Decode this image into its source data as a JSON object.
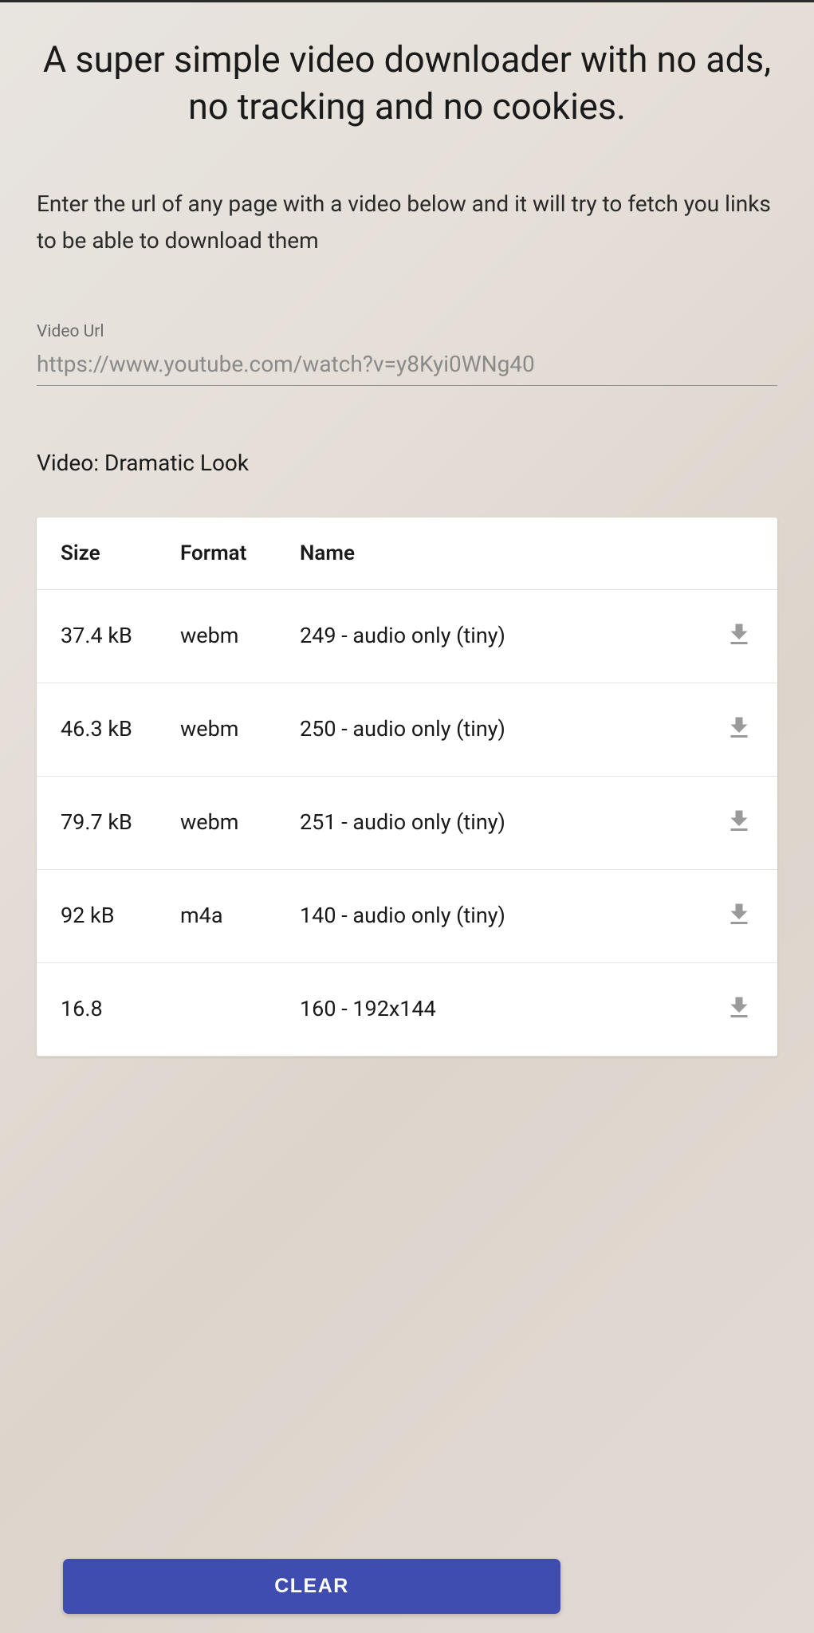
{
  "title": "A super simple video downloader with no ads, no tracking and no cookies.",
  "description": "Enter the url of any page with a video below and it will try to fetch you links to be able to download them",
  "input": {
    "label": "Video Url",
    "value": "https://www.youtube.com/watch?v=y8Kyi0WNg40"
  },
  "video": {
    "title_prefix": "Video: ",
    "title": "Dramatic Look"
  },
  "table": {
    "headers": {
      "size": "Size",
      "format": "Format",
      "name": "Name"
    },
    "rows": [
      {
        "size": "37.4 kB",
        "format": "webm",
        "name": "249 - audio only (tiny)"
      },
      {
        "size": "46.3 kB",
        "format": "webm",
        "name": "250 - audio only (tiny)"
      },
      {
        "size": "79.7 kB",
        "format": "webm",
        "name": "251 - audio only (tiny)"
      },
      {
        "size": "92 kB",
        "format": "m4a",
        "name": "140 - audio only (tiny)"
      },
      {
        "size": "16.8",
        "format": "",
        "name": "160 - 192x144"
      }
    ]
  },
  "buttons": {
    "clear": "CLEAR"
  }
}
